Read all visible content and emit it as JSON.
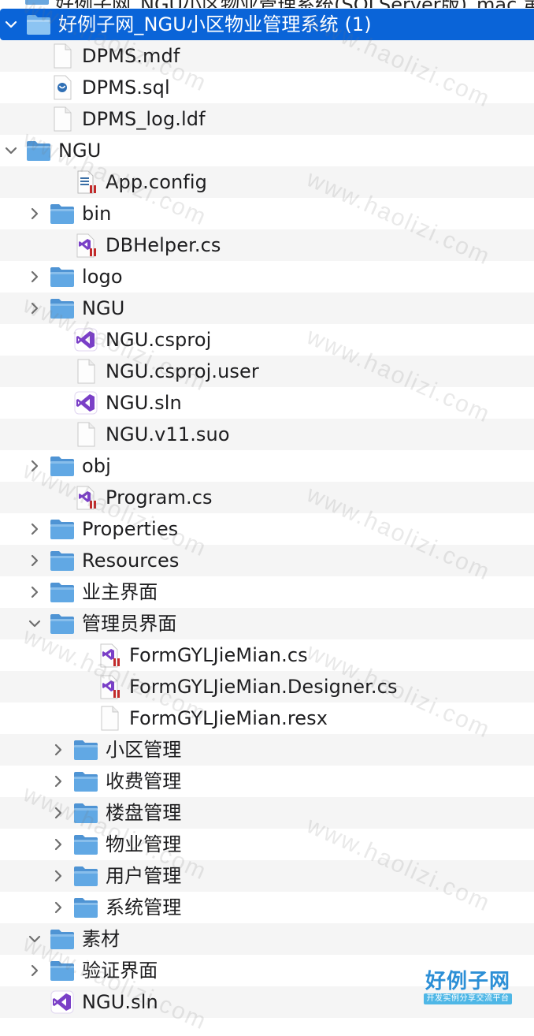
{
  "window": {
    "cut_off_title_fragment": "好例子网_NGU小区物业管理系统(SQLServer版)_mac 第三页",
    "watermark": "www.haolizi.com"
  },
  "colors": {
    "selection": "#0a64d8",
    "folder": "#61a8e4",
    "folder_tab": "#4f94d4",
    "vs_purple": "#7a3fc7",
    "cs_red": "#c22a2a"
  },
  "tree": [
    {
      "label": "好例子网_NGU小区物业管理系统 (1)",
      "depth": 0,
      "kind": "folder",
      "expanded": true,
      "selected": true,
      "name": "folder-root"
    },
    {
      "label": "DPMS.mdf",
      "depth": 1,
      "kind": "blank-file",
      "name": "file-dpms-mdf"
    },
    {
      "label": "DPMS.sql",
      "depth": 1,
      "kind": "sql-file",
      "name": "file-dpms-sql"
    },
    {
      "label": "DPMS_log.ldf",
      "depth": 1,
      "kind": "blank-file",
      "name": "file-dpms-log-ldf"
    },
    {
      "label": "NGU",
      "depth": 0,
      "kind": "folder",
      "expanded": true,
      "name": "folder-ngu"
    },
    {
      "label": "App.config",
      "depth": 2,
      "kind": "config-file",
      "name": "file-app-config"
    },
    {
      "label": "bin",
      "depth": 1,
      "kind": "folder",
      "expanded": false,
      "name": "folder-bin"
    },
    {
      "label": "DBHelper.cs",
      "depth": 2,
      "kind": "cs-file",
      "name": "file-dbhelper-cs"
    },
    {
      "label": "logo",
      "depth": 1,
      "kind": "folder",
      "expanded": false,
      "name": "folder-logo"
    },
    {
      "label": "NGU",
      "depth": 1,
      "kind": "folder",
      "expanded": false,
      "name": "folder-ngu-inner"
    },
    {
      "label": "NGU.csproj",
      "depth": 2,
      "kind": "vs-file",
      "name": "file-ngu-csproj"
    },
    {
      "label": "NGU.csproj.user",
      "depth": 2,
      "kind": "blank-file",
      "name": "file-ngu-csproj-user"
    },
    {
      "label": "NGU.sln",
      "depth": 2,
      "kind": "vs-file",
      "name": "file-ngu-sln-inner"
    },
    {
      "label": "NGU.v11.suo",
      "depth": 2,
      "kind": "blank-file",
      "name": "file-ngu-v11-suo"
    },
    {
      "label": "obj",
      "depth": 1,
      "kind": "folder",
      "expanded": false,
      "name": "folder-obj"
    },
    {
      "label": "Program.cs",
      "depth": 2,
      "kind": "cs-file",
      "name": "file-program-cs"
    },
    {
      "label": "Properties",
      "depth": 1,
      "kind": "folder",
      "expanded": false,
      "name": "folder-properties"
    },
    {
      "label": "Resources",
      "depth": 1,
      "kind": "folder",
      "expanded": false,
      "name": "folder-resources"
    },
    {
      "label": "业主界面",
      "depth": 1,
      "kind": "folder",
      "expanded": false,
      "name": "folder-owner-ui"
    },
    {
      "label": "管理员界面",
      "depth": 1,
      "kind": "folder",
      "expanded": true,
      "name": "folder-admin-ui"
    },
    {
      "label": "FormGYLJieMian.cs",
      "depth": 3,
      "kind": "cs-file",
      "name": "file-formgyljiemian-cs"
    },
    {
      "label": "FormGYLJieMian.Designer.cs",
      "depth": 3,
      "kind": "cs-file",
      "name": "file-formgyljiemian-designer-cs"
    },
    {
      "label": "FormGYLJieMian.resx",
      "depth": 3,
      "kind": "blank-file",
      "name": "file-formgyljiemian-resx"
    },
    {
      "label": "小区管理",
      "depth": 2,
      "kind": "folder",
      "expanded": false,
      "name": "folder-community-mgmt"
    },
    {
      "label": "收费管理",
      "depth": 2,
      "kind": "folder",
      "expanded": false,
      "name": "folder-charge-mgmt"
    },
    {
      "label": "楼盘管理",
      "depth": 2,
      "kind": "folder",
      "expanded": false,
      "name": "folder-building-mgmt"
    },
    {
      "label": "物业管理",
      "depth": 2,
      "kind": "folder",
      "expanded": false,
      "name": "folder-property-mgmt"
    },
    {
      "label": "用户管理",
      "depth": 2,
      "kind": "folder",
      "expanded": false,
      "name": "folder-user-mgmt"
    },
    {
      "label": "系统管理",
      "depth": 2,
      "kind": "folder",
      "expanded": false,
      "name": "folder-system-mgmt"
    },
    {
      "label": "素材",
      "depth": 1,
      "kind": "folder",
      "expanded": true,
      "name": "folder-assets"
    },
    {
      "label": "验证界面",
      "depth": 1,
      "kind": "folder",
      "expanded": false,
      "name": "folder-verify-ui"
    },
    {
      "label": "NGU.sln",
      "depth": 1,
      "kind": "vs-file",
      "name": "file-ngu-sln"
    }
  ],
  "logo": {
    "title": "好例子网",
    "subtitle": "开发实例分享交流平台"
  }
}
